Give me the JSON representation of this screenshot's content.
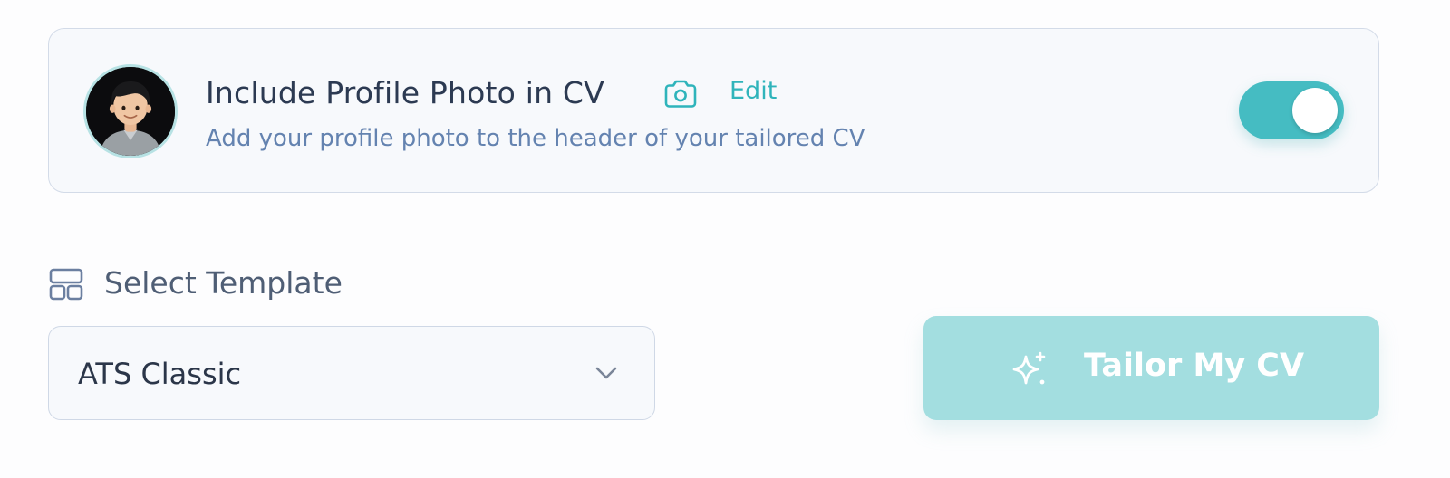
{
  "photo_option": {
    "title": "Include Profile Photo in CV",
    "edit_label": "Edit",
    "subtitle": "Add your profile photo to the header of your tailored CV",
    "toggle_on": true,
    "camera_icon": "camera-icon",
    "avatar_icon": "avatar"
  },
  "template": {
    "label": "Select Template",
    "icon": "layout-template-icon",
    "selected": "ATS Classic",
    "chevron_icon": "chevron-down-icon"
  },
  "cta": {
    "label": "Tailor My CV",
    "icon": "sparkle-icon"
  },
  "colors": {
    "accent": "#45bcc2",
    "accent_light": "#a3dee0",
    "edit_link": "#2fb4bb",
    "title_text": "#2c3a52",
    "subtitle_text": "#6483b0",
    "card_border": "#d3dbe8"
  }
}
